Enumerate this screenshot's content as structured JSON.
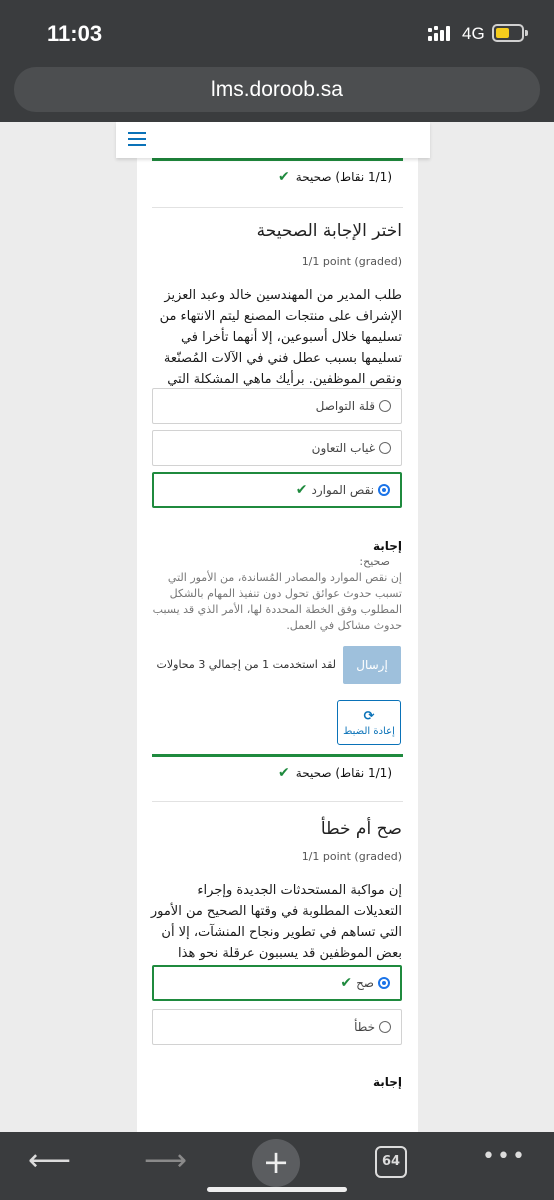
{
  "status": {
    "time": "11:03",
    "network": "4G"
  },
  "browser": {
    "url": "lms.doroob.sa",
    "tab_count": "64"
  },
  "score_1": "(1/1 نقاط) صحيحة",
  "problem_1": {
    "title": "اختر الإجابة الصحيحة",
    "points": "1/1 point (graded)",
    "question": "طلب المدير من المهندسين خالد وعبد العزيز الإشراف على منتجات المصنع ليتم الانتهاء من تسليمها خلال أسبوعين، إلا أنهما تأخرا في تسليمها بسبب عطل فني في الآلات المُصنّعة ونقص الموظفين. برأيك ماهي المشكلة التي تسببت في ذلك؟",
    "options": [
      "قلة التواصل",
      "غياب التعاون",
      "نقص الموارد"
    ],
    "answer_title": "إجابة",
    "answer_status": "صحيح:",
    "answer_body": "إن نقص الموارد والمصادر المُساندة، من الأمور التي تسبب حدوث عوائق تحول دون تنفيذ المهام بالشكل المطلوب وفق الخطة المحددة لها، الأمر الذي قد يسبب حدوث مشاكل في العمل.",
    "submit_label": "إرسال",
    "attempts": "لقد استخدمت 1 من إجمالي 3 محاولات",
    "reset_label": "إعادة الضبط"
  },
  "score_2": "(1/1 نقاط) صحيحة",
  "problem_2": {
    "title": "صح أم خطأ",
    "points": "1/1 point (graded)",
    "question": "إن مواكبة المستحدثات الجديدة وإجراء التعديلات المطلوبة في وقتها الصحيح من الأمور التي تساهم في تطوير ونجاح المنشآت، إلا أن بعض الموظفين قد يسببون عرقلة نحو هذا التطور.",
    "options": [
      "صح",
      "خطأ"
    ],
    "answer_title": "إجابة"
  }
}
